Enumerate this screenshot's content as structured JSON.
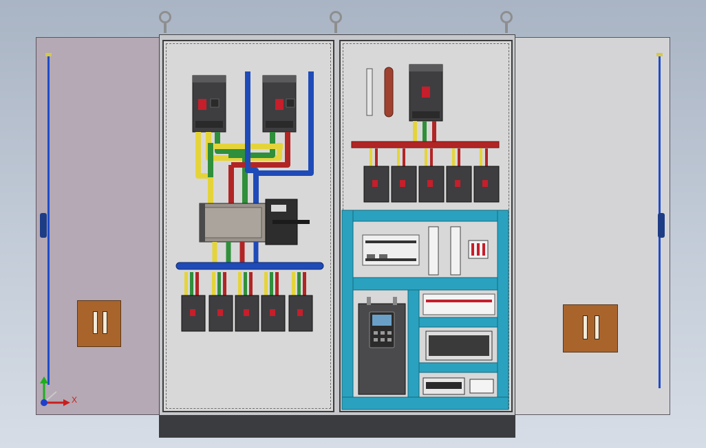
{
  "axis_triad": {
    "x_label": "X"
  },
  "colors": {
    "phase_l1": "#e4d43a",
    "phase_l2": "#2f8f3a",
    "phase_l3": "#b22525",
    "neutral": "#1f4bb8",
    "mounting_rail": "#2aa2bf",
    "breaker_body": "#3c3c3c",
    "door_left": "#b4a9b4",
    "door_right": "#d4d4d6"
  },
  "icons": [
    "lifting-eye-icon",
    "door-handle-icon",
    "document-pocket-icon",
    "axis-triad-icon"
  ]
}
